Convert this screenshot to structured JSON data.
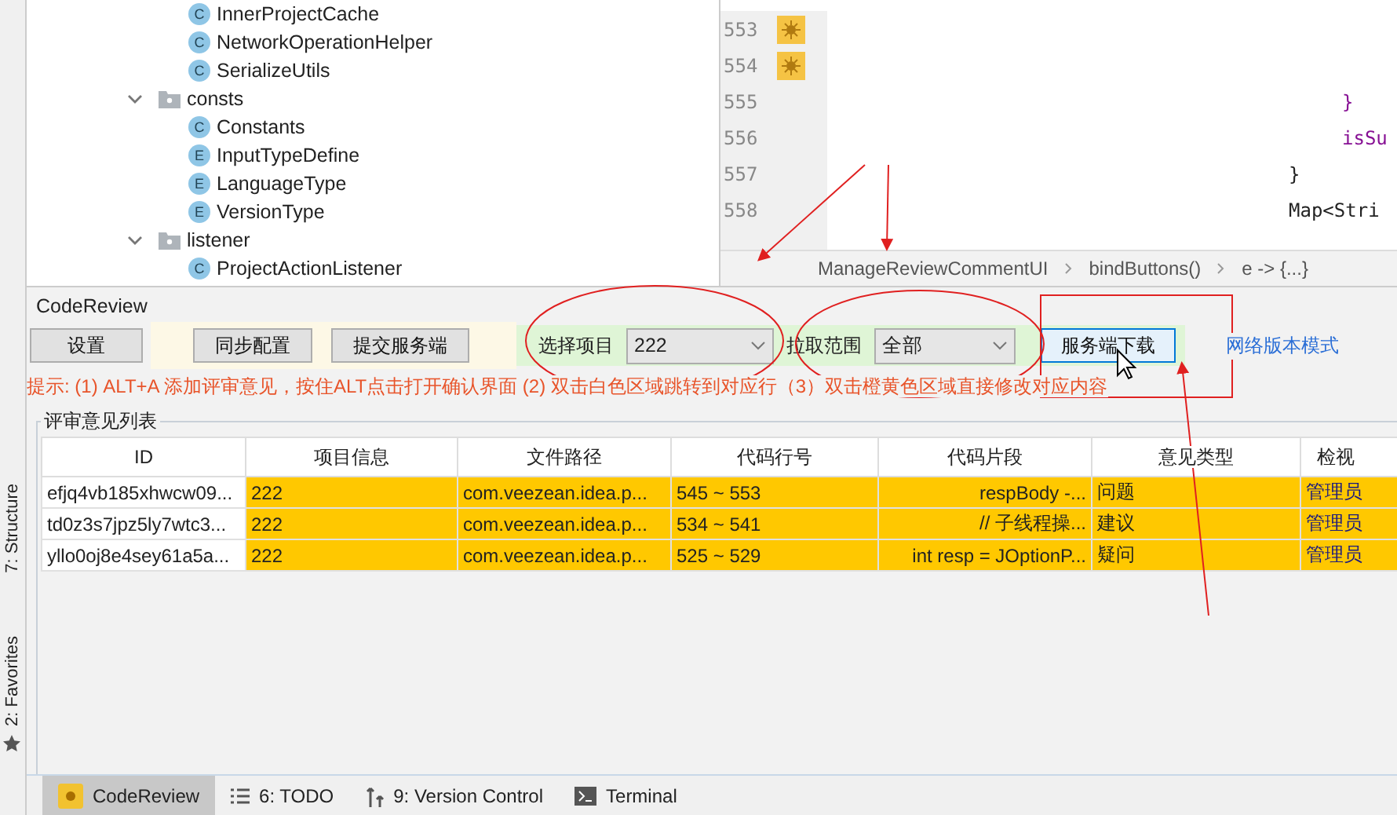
{
  "project_tree": [
    {
      "kind": "class",
      "badge": "C",
      "label": "InnerProjectCache"
    },
    {
      "kind": "class",
      "badge": "C",
      "label": "NetworkOperationHelper"
    },
    {
      "kind": "class",
      "badge": "C",
      "label": "SerializeUtils"
    },
    {
      "kind": "folder",
      "label": "consts",
      "expanded": true,
      "children": [
        {
          "kind": "class",
          "badge": "C",
          "label": "Constants"
        },
        {
          "kind": "class",
          "badge": "E",
          "label": "InputTypeDefine"
        },
        {
          "kind": "class",
          "badge": "E",
          "label": "LanguageType"
        },
        {
          "kind": "class",
          "badge": "E",
          "label": "VersionType"
        }
      ]
    },
    {
      "kind": "folder",
      "label": "listener",
      "expanded": true,
      "children": [
        {
          "kind": "class",
          "badge": "C",
          "label": "ProjectActionListener"
        }
      ]
    }
  ],
  "editor": {
    "lines": [
      {
        "number": "553",
        "marker": true
      },
      {
        "number": "554",
        "marker": true
      },
      {
        "number": "555",
        "marker": false,
        "kind": "inner",
        "code": "}"
      },
      {
        "number": "556",
        "marker": false,
        "kind": "inner",
        "code": "isSu"
      },
      {
        "number": "557",
        "marker": false,
        "kind": "outer",
        "code": "}"
      },
      {
        "number": "558",
        "marker": false,
        "kind": "outer",
        "code": "Map<Stri"
      }
    ],
    "breadcrumbs": [
      "ManageReviewCommentUI",
      "bindButtons()",
      "e -> {...}"
    ]
  },
  "side_stripe": [
    "7: Structure",
    "2: Favorites"
  ],
  "panel": {
    "title": "CodeReview",
    "buttons": [
      "设置",
      "同步配置",
      "提交服务端"
    ],
    "project_label": "选择项目",
    "project_value": "222",
    "range_label": "拉取范围",
    "range_value": "全部",
    "download_button": "服务端下载",
    "network_link": "网络版本模式",
    "hint": "提示: (1) ALT+A 添加评审意见，按住ALT点击打开确认界面 (2) 双击白色区域跳转到对应行（3）双击橙黄色区域直接修改对应内容",
    "group_title": "评审意见列表",
    "table": {
      "columns": [
        "ID",
        "项目信息",
        "文件路径",
        "代码行号",
        "代码片段",
        "意见类型",
        "检视"
      ],
      "rows": [
        [
          "efjq4vb185xhwcw09...",
          "222",
          "com.veezean.idea.p...",
          "545 ~ 553",
          "respBody -...",
          "问题",
          "管理员"
        ],
        [
          "td0z3s7jpz5ly7wtc3...",
          "222",
          "com.veezean.idea.p...",
          "534 ~ 541",
          "// 子线程操...",
          "建议",
          "管理员"
        ],
        [
          "yllo0oj8e4sey61a5a...",
          "222",
          "com.veezean.idea.p...",
          "525 ~ 529",
          "int resp = JOptionP...",
          "疑问",
          "管理员"
        ]
      ]
    }
  },
  "bottom_tabs": [
    {
      "label": "CodeReview",
      "selected": true,
      "kind": "review"
    },
    {
      "label": "6: TODO",
      "selected": false,
      "kind": "todo"
    },
    {
      "label": "9: Version Control",
      "selected": false,
      "kind": "vcs"
    },
    {
      "label": "Terminal",
      "selected": false,
      "kind": "terminal"
    }
  ]
}
